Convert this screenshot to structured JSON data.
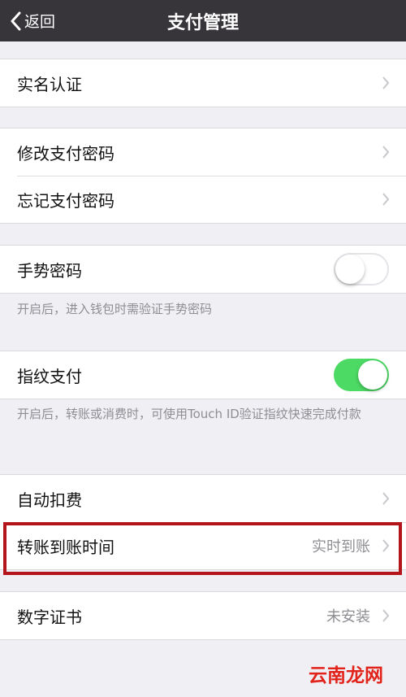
{
  "nav": {
    "back_label": "返回",
    "title": "支付管理"
  },
  "groups": {
    "realname": {
      "label": "实名认证"
    },
    "password": {
      "change_label": "修改支付密码",
      "forgot_label": "忘记支付密码"
    },
    "gesture": {
      "label": "手势密码",
      "enabled": false,
      "footnote": "开启后，进入钱包时需验证手势密码"
    },
    "fingerprint": {
      "label": "指纹支付",
      "enabled": true,
      "footnote": "开启后，转账或消费时，可使用Touch ID验证指纹快速完成付款"
    },
    "transfer": {
      "auto_deduct_label": "自动扣费",
      "arrival_time_label": "转账到账时间",
      "arrival_time_value": "实时到账"
    },
    "certificate": {
      "label": "数字证书",
      "value": "未安装"
    }
  },
  "watermark": "云南龙网",
  "colors": {
    "navbar": "#37353a",
    "toggle_on": "#4cd964",
    "highlight_border": "#b3151b",
    "watermark": "#e2231a",
    "background": "#efeff4"
  },
  "icons": [
    "chevron-left-icon",
    "chevron-right-icon"
  ]
}
